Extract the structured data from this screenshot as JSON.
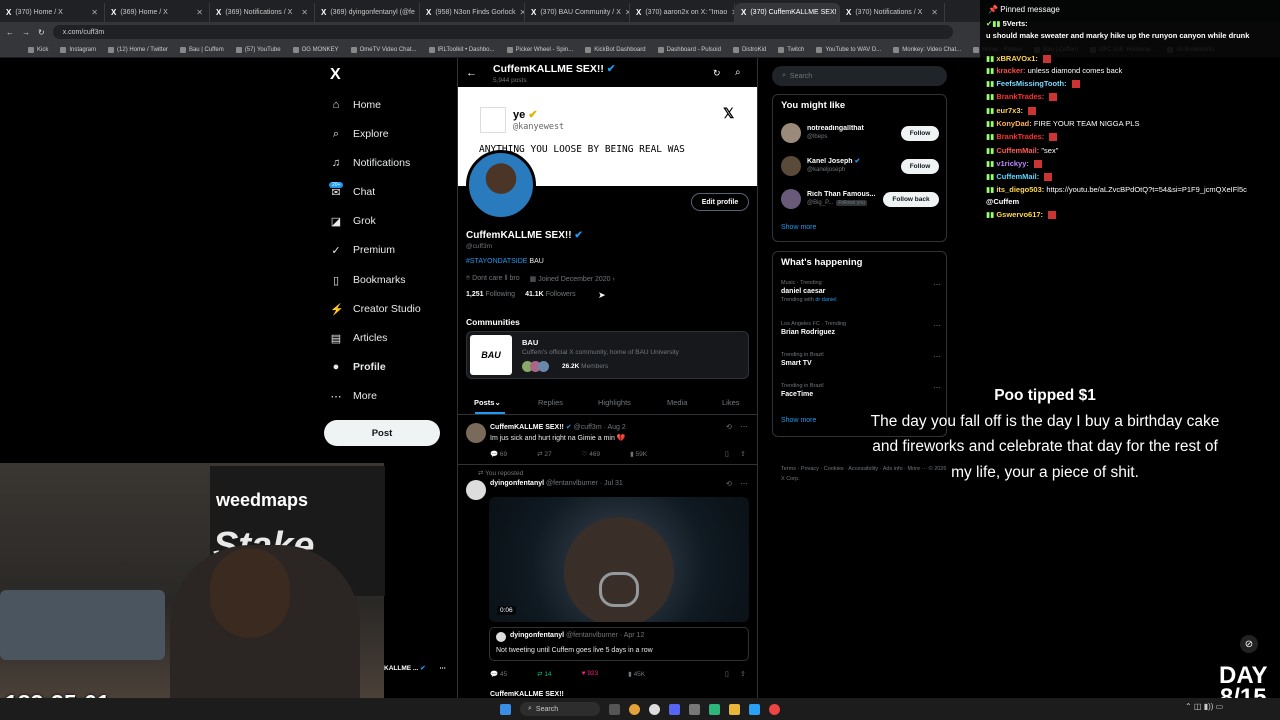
{
  "browser": {
    "tabs": [
      {
        "label": "(370) Home / X",
        "active": false
      },
      {
        "label": "(369) Home / X",
        "active": false
      },
      {
        "label": "(369) Notifications / X",
        "active": false
      },
      {
        "label": "(369) dyingonfentanyl (@fe",
        "active": false
      },
      {
        "label": "(958) N3on Finds Gorlock",
        "active": false
      },
      {
        "label": "(370) BAU Community / X",
        "active": false
      },
      {
        "label": "(370) aaron2x on X: \"Imao",
        "active": false
      },
      {
        "label": "(370) CuffemKALLME SEX!",
        "active": true
      },
      {
        "label": "(370) Notifications / X",
        "active": false
      }
    ],
    "url": "x.com/cuff3m",
    "bookmarks": [
      "Kick",
      "Instagram",
      "(12) Home / Twitter",
      "Bau | Cuffem",
      "(57) YouTube",
      "OG MONKEY",
      "OmeTV Video Chat...",
      "IRLToolkit • Dashbo...",
      "Picker Wheel - Spin...",
      "KickBot Dashboard",
      "Dashboard - Pulsoid",
      "DistroKid",
      "Twitch",
      "YouTube to WAV D...",
      "Monkey: Video Chat...",
      "Home - Roblox",
      "Bau | Cuffem",
      "UFC 326: Holloway...",
      "All Bookmarks"
    ]
  },
  "sidebar": {
    "logo": "X",
    "items": [
      {
        "label": "Home",
        "icon": "home-icon",
        "glyph": "⌂"
      },
      {
        "label": "Explore",
        "icon": "search-icon",
        "glyph": "⌕"
      },
      {
        "label": "Notifications",
        "icon": "bell-icon",
        "glyph": "♫"
      },
      {
        "label": "Chat",
        "icon": "chat-icon",
        "glyph": "✉"
      },
      {
        "label": "Grok",
        "icon": "grok-icon",
        "glyph": "◪"
      },
      {
        "label": "Premium",
        "icon": "premium-icon",
        "glyph": "✓"
      },
      {
        "label": "Bookmarks",
        "icon": "bookmark-icon",
        "glyph": "▯"
      },
      {
        "label": "Creator Studio",
        "icon": "creator-studio-icon",
        "glyph": "⚡"
      },
      {
        "label": "Articles",
        "icon": "articles-icon",
        "glyph": "▤"
      },
      {
        "label": "Profile",
        "icon": "profile-icon",
        "glyph": "●"
      },
      {
        "label": "More",
        "icon": "more-icon",
        "glyph": "⋯"
      }
    ],
    "chat_badge": "20+",
    "post_label": "Post"
  },
  "profile": {
    "header_name": "CuffemKALLME SEX!!",
    "header_posts": "5,944 posts",
    "banner": {
      "name": "ye",
      "handle": "@kanyewest",
      "text": "ANYTHING YOU LOOSE BY BEING REAL WAS"
    },
    "edit_label": "Edit profile",
    "name": "CuffemKALLME SEX!!",
    "handle": "@cuff3m",
    "bio_tag": "#STAYONDATSIDE",
    "bio_rest": " BAU",
    "location": "Dont care ll bro",
    "joined": "Joined December 2020",
    "following_count": "1,251",
    "following_label": "Following",
    "followers_count": "41.1K",
    "followers_label": "Followers"
  },
  "communities": {
    "title": "Communities",
    "name": "BAU",
    "desc": "Cuffem's official X community, home of BAU University",
    "members_count": "26.2K",
    "members_label": "Members",
    "img_text": "BAU"
  },
  "tabs": [
    "Posts",
    "Replies",
    "Highlights",
    "Media",
    "Likes"
  ],
  "tweets": {
    "t1": {
      "name": "CuffemKALLME SEX!!",
      "handle": "@cuff3m · Aug 2",
      "text": "Im jus sick and hurt right na Gimie a min 💔",
      "replies": "69",
      "retweets": "27",
      "likes": "469",
      "views": "59K"
    },
    "reposted": "You reposted",
    "t2": {
      "name": "dyingonfentanyl",
      "handle": "@fentanvlburner · Jul 31",
      "video_time": "0:06"
    },
    "quote": {
      "name": "dyingonfentanyl",
      "handle": "@fentanvlburner · Apr 12",
      "text": "Not tweeting until Cuffem goes live 5 days in a row"
    },
    "t2_actions": {
      "replies": "45",
      "retweets": "14",
      "likes": "923",
      "views": "45K"
    },
    "t3_name": "CuffemKALLME SEX!!"
  },
  "right": {
    "search_placeholder": "Search",
    "yml_title": "You might like",
    "yml": [
      {
        "name": "notreadingallthat",
        "handle": "@lbeps",
        "button": "Follow"
      },
      {
        "name": "Kanel Joseph",
        "handle": "@kaneljoseph",
        "button": "Follow"
      },
      {
        "name": "Rich Than Famous...",
        "handle": "@Big_P...",
        "note": "Follows you",
        "button": "Follow back"
      }
    ],
    "show_more": "Show more",
    "wh_title": "What's happening",
    "trends": [
      {
        "cat": "Music · Trending",
        "title": "daniel caesar",
        "extra": "Trending with",
        "link": "dr daniel"
      },
      {
        "cat": "Los Angeles FC · Trending",
        "title": "Brian Rodriguez"
      },
      {
        "cat": "Trending in Brazil",
        "title": "Smart TV"
      },
      {
        "cat": "Trending in Brazil",
        "title": "FaceTime"
      }
    ],
    "footer": "Terms · Privacy · Cookies · Accessibility · Ads info · More ··· © 2026 X Corp."
  },
  "chat": {
    "pinned_label": "Pinned message",
    "pinned_user": "5Verts:",
    "pinned_text": "u should make sweater and marky hike up the runyon canyon while drunk",
    "messages": [
      {
        "user": "xBRAVOx1:",
        "text": ""
      },
      {
        "user": "kracker:",
        "text": "unless diamond comes back"
      },
      {
        "user": "FeefsMissingTooth:",
        "text": ""
      },
      {
        "user": "BrankTrades:",
        "text": ""
      },
      {
        "user": "eur7x3:",
        "text": ""
      },
      {
        "user": "KonyDad:",
        "text": "FIRE YOUR TEAM NIGGA PLS"
      },
      {
        "user": "BrankTrades:",
        "text": ""
      },
      {
        "user": "CuffemMail:",
        "text": "\"sex\""
      },
      {
        "user": "v1rickyy:",
        "text": ""
      },
      {
        "user": "CuffemMail:",
        "text": ""
      },
      {
        "user": "its_diego503:",
        "text": "https://youtu.be/aLZvcBPdOtQ?t=54&si=P1F9_jcmQXeIFl5c"
      },
      {
        "user": "",
        "text": "@Cuffem"
      },
      {
        "user": "Gswervo617:",
        "text": ""
      }
    ]
  },
  "donation": {
    "header": "Poo tipped $1",
    "message": "The day you fall off is the day I buy a birthday cake and fireworks and celebrate that day for the rest of my life, your a piece of shit."
  },
  "stream": {
    "timer": "183:35:01",
    "day": "DAY",
    "day_count": "8/15",
    "webcam_text1": "weedmaps",
    "webcam_text2": "Stake",
    "account_name": "KALLME ..."
  },
  "taskbar": {
    "search": "Search"
  }
}
